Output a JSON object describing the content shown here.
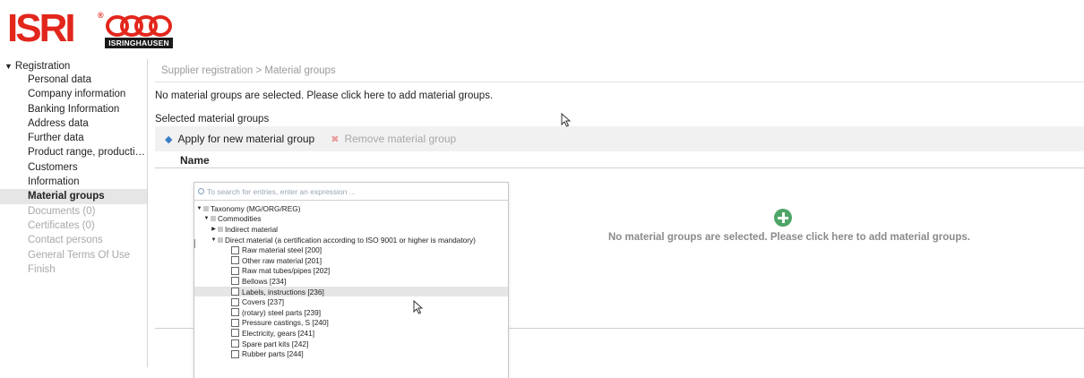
{
  "logo": {
    "wordmark": "ISRI",
    "registered": "®",
    "subtitle": "ISRINGHAUSEN",
    "color": "#e2261c"
  },
  "sidebar": {
    "group_label": "Registration",
    "items": [
      {
        "label": "Personal data",
        "state": "normal"
      },
      {
        "label": "Company information",
        "state": "normal"
      },
      {
        "label": "Banking Information",
        "state": "normal"
      },
      {
        "label": "Address data",
        "state": "normal"
      },
      {
        "label": "Further data",
        "state": "normal"
      },
      {
        "label": "Product range, productio...",
        "state": "normal"
      },
      {
        "label": "Customers",
        "state": "normal"
      },
      {
        "label": "Information",
        "state": "normal"
      },
      {
        "label": "Material groups",
        "state": "active"
      },
      {
        "label": "Documents (0)",
        "state": "disabled"
      },
      {
        "label": "Certificates (0)",
        "state": "disabled"
      },
      {
        "label": "Contact persons",
        "state": "disabled"
      },
      {
        "label": "General Terms Of Use",
        "state": "disabled"
      },
      {
        "label": "Finish",
        "state": "disabled"
      }
    ]
  },
  "main": {
    "breadcrumb": "Supplier registration > Material groups",
    "info_message": "No material groups are selected. Please click here to add material groups.",
    "section_label": "Selected material groups",
    "toolbar": {
      "apply_label": "Apply for new material group",
      "remove_label": "Remove material group"
    },
    "table": {
      "column_name": "Name",
      "empty_message": "No material groups are selected. Please click here to add material groups."
    }
  },
  "tree": {
    "search_placeholder": "To search for entries, enter an expression ...",
    "nodes": [
      {
        "label": "Taxonomy (MG/ORG/REG)",
        "level": 0,
        "toggle": "expanded",
        "kind": "folder"
      },
      {
        "label": "Commodities",
        "level": 1,
        "toggle": "expanded",
        "kind": "folder"
      },
      {
        "label": "Indirect material",
        "level": 2,
        "toggle": "collapsed",
        "kind": "folder"
      },
      {
        "label": "Direct material (a certification according to ISO 9001 or higher is mandatory)",
        "level": 2,
        "toggle": "expanded",
        "kind": "folder"
      },
      {
        "label": "Raw material steel [200]",
        "level": 3,
        "kind": "checkbox"
      },
      {
        "label": "Other raw material [201]",
        "level": 3,
        "kind": "checkbox"
      },
      {
        "label": "Raw mat tubes/pipes [202]",
        "level": 3,
        "kind": "checkbox"
      },
      {
        "label": "Bellows [234]",
        "level": 3,
        "kind": "checkbox"
      },
      {
        "label": "Labels, instructions [236]",
        "level": 3,
        "kind": "checkbox",
        "highlighted": true
      },
      {
        "label": "Covers [237]",
        "level": 3,
        "kind": "checkbox"
      },
      {
        "label": "(rotary) steel parts [239]",
        "level": 3,
        "kind": "checkbox"
      },
      {
        "label": "Pressure castings, S [240]",
        "level": 3,
        "kind": "checkbox"
      },
      {
        "label": "Electricity, gears [241]",
        "level": 3,
        "kind": "checkbox"
      },
      {
        "label": "Spare part kits [242]",
        "level": 3,
        "kind": "checkbox"
      },
      {
        "label": "Rubber parts [244]",
        "level": 3,
        "kind": "checkbox"
      }
    ]
  },
  "colors": {
    "accent_blue": "#3a7fc4",
    "add_green": "#4fa568",
    "remove_red": "#e89a9a"
  }
}
